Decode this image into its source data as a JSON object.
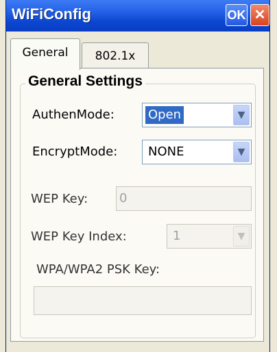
{
  "window": {
    "title": "WiFiConfig",
    "ok_label": "OK",
    "close_glyph": "✕"
  },
  "tabs": [
    {
      "label": "General",
      "active": true
    },
    {
      "label": "802.1x",
      "active": false
    }
  ],
  "group": {
    "title": "General Settings"
  },
  "fields": {
    "authen_mode": {
      "label": "AuthenMode:",
      "value": "Open"
    },
    "encrypt_mode": {
      "label": "EncryptMode:",
      "value": "NONE"
    },
    "wep_key": {
      "label": "WEP Key:",
      "value": "0"
    },
    "wep_key_index": {
      "label": "WEP Key Index:",
      "value": "1"
    },
    "wpa_psk_key": {
      "label": "WPA/WPA2 PSK Key:",
      "value": ""
    }
  },
  "icons": {
    "dropdown_arrow": "⌵"
  }
}
